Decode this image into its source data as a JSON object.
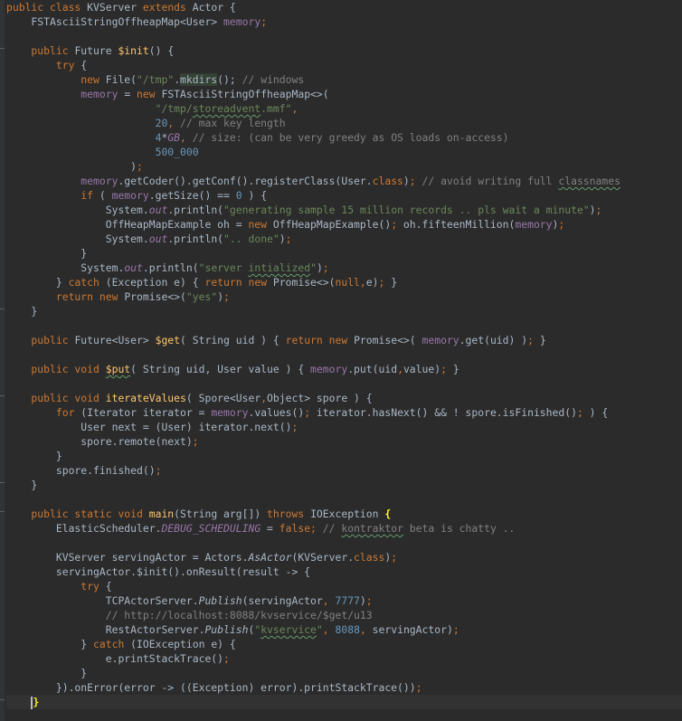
{
  "editor": {
    "language": "java",
    "colors": {
      "background": "#2b2b2b",
      "keyword": "#cc7832",
      "string": "#6a8759",
      "number": "#6897bb",
      "comment": "#808080",
      "field": "#9876aa",
      "method": "#ffc66d",
      "text": "#a9b7c6"
    },
    "current_line": 48,
    "lines": [
      [
        [
          "kw",
          "public class "
        ],
        [
          "plain",
          "KVServer "
        ],
        [
          "kw",
          "extends "
        ],
        [
          "plain",
          "Actor {"
        ]
      ],
      [
        [
          "plain",
          "    FSTAsciiStringOffheapMap<User> "
        ],
        [
          "fld",
          "memory"
        ],
        [
          "kw",
          ";"
        ]
      ],
      [],
      [
        [
          "kw",
          "    public "
        ],
        [
          "plain",
          "Future "
        ],
        [
          "meth",
          "$init"
        ],
        [
          "plain",
          "() {"
        ]
      ],
      [
        [
          "kw",
          "        try "
        ],
        [
          "plain",
          "{"
        ]
      ],
      [
        [
          "kw",
          "            new "
        ],
        [
          "plain",
          "File("
        ],
        [
          "str",
          "\"/tmp\""
        ],
        [
          "plain",
          "."
        ],
        [
          "hl",
          "mkdirs"
        ],
        [
          "plain",
          "(); "
        ],
        [
          "cmt",
          "// windows"
        ]
      ],
      [
        [
          "fld",
          "            memory "
        ],
        [
          "plain",
          "= "
        ],
        [
          "kw",
          "new "
        ],
        [
          "plain",
          "FSTAsciiStringOffheapMap<>("
        ]
      ],
      [
        [
          "str",
          "                        \"/tmp/"
        ],
        [
          "str typo",
          "storeadvent"
        ],
        [
          "str",
          ".mmf\""
        ],
        [
          "kw",
          ","
        ]
      ],
      [
        [
          "num",
          "                        20"
        ],
        [
          "kw",
          ", "
        ],
        [
          "cmt",
          "// max key length"
        ]
      ],
      [
        [
          "num",
          "                        4"
        ],
        [
          "plain",
          "*"
        ],
        [
          "stat",
          "GB"
        ],
        [
          "kw",
          ", "
        ],
        [
          "cmt",
          "// size: (can be very greedy as OS loads on-access)"
        ]
      ],
      [
        [
          "num",
          "                        500_000"
        ]
      ],
      [
        [
          "plain",
          "                    )"
        ],
        [
          "kw",
          ";"
        ]
      ],
      [
        [
          "fld",
          "            memory"
        ],
        [
          "plain",
          ".getCoder().getConf().registerClass(User."
        ],
        [
          "kw",
          "class"
        ],
        [
          "plain",
          ")"
        ],
        [
          "kw",
          "; "
        ],
        [
          "cmt",
          "// avoid writing full "
        ],
        [
          "cmt typo",
          "classnames"
        ]
      ],
      [
        [
          "kw",
          "            if "
        ],
        [
          "plain",
          "( "
        ],
        [
          "fld",
          "memory"
        ],
        [
          "plain",
          ".getSize() == "
        ],
        [
          "num",
          "0 "
        ],
        [
          "plain",
          ") {"
        ]
      ],
      [
        [
          "plain",
          "                System."
        ],
        [
          "stat",
          "out"
        ],
        [
          "plain",
          ".println("
        ],
        [
          "str",
          "\"generating sample 15 million records .. pls wait a minute\""
        ],
        [
          "plain",
          ")"
        ],
        [
          "kw",
          ";"
        ]
      ],
      [
        [
          "plain",
          "                OffHeapMapExample oh = "
        ],
        [
          "kw",
          "new "
        ],
        [
          "plain",
          "OffHeapMapExample()"
        ],
        [
          "kw",
          "; "
        ],
        [
          "plain",
          "oh.fifteenMillion("
        ],
        [
          "fld",
          "memory"
        ],
        [
          "plain",
          ")"
        ],
        [
          "kw",
          ";"
        ]
      ],
      [
        [
          "plain",
          "                System."
        ],
        [
          "stat",
          "out"
        ],
        [
          "plain",
          ".println("
        ],
        [
          "str",
          "\".. done\""
        ],
        [
          "plain",
          ")"
        ],
        [
          "kw",
          ";"
        ]
      ],
      [
        [
          "plain",
          "            }"
        ]
      ],
      [
        [
          "plain",
          "            System."
        ],
        [
          "stat",
          "out"
        ],
        [
          "plain",
          ".println("
        ],
        [
          "str",
          "\"server "
        ],
        [
          "str typo",
          "intialized"
        ],
        [
          "str",
          "\""
        ],
        [
          "plain",
          ")"
        ],
        [
          "kw",
          ";"
        ]
      ],
      [
        [
          "plain",
          "        } "
        ],
        [
          "kw",
          "catch "
        ],
        [
          "plain",
          "(Exception e) { "
        ],
        [
          "kw",
          "return new "
        ],
        [
          "plain",
          "Promise<>("
        ],
        [
          "kw",
          "null,"
        ],
        [
          "plain",
          "e)"
        ],
        [
          "kw",
          "; "
        ],
        [
          "plain",
          "}"
        ]
      ],
      [
        [
          "kw",
          "        return new "
        ],
        [
          "plain",
          "Promise<>("
        ],
        [
          "str",
          "\"yes\""
        ],
        [
          "plain",
          ")"
        ],
        [
          "kw",
          ";"
        ]
      ],
      [
        [
          "plain",
          "    }"
        ]
      ],
      [],
      [
        [
          "kw",
          "    public "
        ],
        [
          "plain",
          "Future<User> "
        ],
        [
          "meth",
          "$get"
        ],
        [
          "plain",
          "( String uid ) { "
        ],
        [
          "kw",
          "return new "
        ],
        [
          "plain",
          "Promise<>( "
        ],
        [
          "fld",
          "memory"
        ],
        [
          "plain",
          ".get(uid) )"
        ],
        [
          "kw",
          "; "
        ],
        [
          "plain",
          "}"
        ]
      ],
      [],
      [
        [
          "kw",
          "    public void "
        ],
        [
          "meth typo",
          "$put"
        ],
        [
          "plain",
          "( String uid, User value ) { "
        ],
        [
          "fld",
          "memory"
        ],
        [
          "plain",
          ".put(uid"
        ],
        [
          "kw",
          ","
        ],
        [
          "plain",
          "value)"
        ],
        [
          "kw",
          "; "
        ],
        [
          "plain",
          "}"
        ]
      ],
      [],
      [
        [
          "kw",
          "    public void "
        ],
        [
          "meth",
          "iterateValues"
        ],
        [
          "plain",
          "( Spore<User"
        ],
        [
          "kw",
          ","
        ],
        [
          "plain",
          "Object> spore ) {"
        ]
      ],
      [
        [
          "kw",
          "        for "
        ],
        [
          "plain",
          "(Iterator iterator = "
        ],
        [
          "fld",
          "memory"
        ],
        [
          "plain",
          ".values()"
        ],
        [
          "kw",
          "; "
        ],
        [
          "plain",
          "iterator.hasNext() && ! spore.isFinished()"
        ],
        [
          "kw",
          "; "
        ],
        [
          "plain",
          ") {"
        ]
      ],
      [
        [
          "plain",
          "            User next = (User) iterator.next()"
        ],
        [
          "kw",
          ";"
        ]
      ],
      [
        [
          "plain",
          "            spore.remote(next)"
        ],
        [
          "kw",
          ";"
        ]
      ],
      [
        [
          "plain",
          "        }"
        ]
      ],
      [
        [
          "plain",
          "        spore.finished()"
        ],
        [
          "kw",
          ";"
        ]
      ],
      [
        [
          "plain",
          "    }"
        ]
      ],
      [],
      [
        [
          "kw",
          "    public static void "
        ],
        [
          "meth",
          "main"
        ],
        [
          "plain",
          "(String arg[]) "
        ],
        [
          "kw",
          "throws "
        ],
        [
          "plain",
          "IOException "
        ],
        [
          "brace-match",
          "{"
        ]
      ],
      [
        [
          "plain",
          "        ElasticScheduler."
        ],
        [
          "stat",
          "DEBUG_SCHEDULING "
        ],
        [
          "plain",
          "= "
        ],
        [
          "kw",
          "false; "
        ],
        [
          "cmt",
          "// "
        ],
        [
          "cmt typo",
          "kontraktor"
        ],
        [
          "cmt",
          " beta is chatty .."
        ]
      ],
      [],
      [
        [
          "plain",
          "        KVServer servingActor = Actors."
        ],
        [
          "ital",
          "AsActor"
        ],
        [
          "plain",
          "(KVServer."
        ],
        [
          "kw",
          "class"
        ],
        [
          "plain",
          ")"
        ],
        [
          "kw",
          ";"
        ]
      ],
      [
        [
          "plain",
          "        servingActor.$init().onResult(result -> {"
        ]
      ],
      [
        [
          "kw",
          "            try "
        ],
        [
          "plain",
          "{"
        ]
      ],
      [
        [
          "plain",
          "                TCPActorServer."
        ],
        [
          "ital",
          "Publish"
        ],
        [
          "plain",
          "(servingActor"
        ],
        [
          "kw",
          ", "
        ],
        [
          "num",
          "7777"
        ],
        [
          "plain",
          ")"
        ],
        [
          "kw",
          ";"
        ]
      ],
      [
        [
          "cmt",
          "                // http://localhost:8088/kvservice/$get/u13"
        ]
      ],
      [
        [
          "plain",
          "                RestActorServer."
        ],
        [
          "ital",
          "Publish"
        ],
        [
          "plain",
          "("
        ],
        [
          "str",
          "\""
        ],
        [
          "str typo",
          "kvservice"
        ],
        [
          "str",
          "\""
        ],
        [
          "kw",
          ", "
        ],
        [
          "num",
          "8088"
        ],
        [
          "kw",
          ", "
        ],
        [
          "plain",
          "servingActor)"
        ],
        [
          "kw",
          ";"
        ]
      ],
      [
        [
          "plain",
          "            } "
        ],
        [
          "kw",
          "catch "
        ],
        [
          "plain",
          "(IOException e) {"
        ]
      ],
      [
        [
          "plain",
          "                e.printStackTrace()"
        ],
        [
          "kw",
          ";"
        ]
      ],
      [
        [
          "plain",
          "            }"
        ]
      ],
      [
        [
          "plain",
          "        }).onError(error -> ((Exception) error).printStackTrace())"
        ],
        [
          "kw",
          ";"
        ]
      ],
      [
        [
          "plain",
          "    "
        ],
        [
          "caret",
          ""
        ],
        [
          "brace-match",
          "}"
        ]
      ]
    ]
  }
}
